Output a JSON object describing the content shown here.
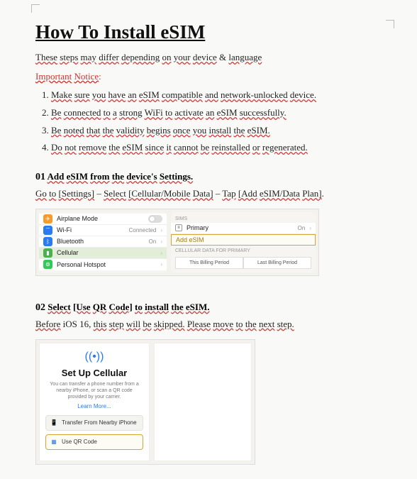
{
  "title": "How To Install eSIM",
  "intro": {
    "t1": "These",
    "t2": "steps",
    "t3": "may",
    "t4": "differ",
    "t5": "depending",
    "t6": "on",
    "t7": "your",
    "t8": "device",
    "amp": "&",
    "t9": "language"
  },
  "important": {
    "w1": "Important",
    "w2": "Notice",
    "colon": ":"
  },
  "steps": [
    {
      "n": "1.",
      "parts": [
        "Make",
        "sure",
        "you",
        "have",
        "an",
        "eSIM",
        "compatible",
        "and",
        "network-unlocked",
        "device."
      ]
    },
    {
      "n": "2.",
      "parts": [
        "Be",
        "connected",
        "to",
        "a",
        "strong",
        "WiFi",
        "to",
        "activate",
        "an",
        "eSIM",
        "successfully."
      ]
    },
    {
      "n": "3.",
      "parts": [
        "Be",
        "noted",
        "that",
        "the",
        "validity",
        "begins",
        "once",
        "you",
        "install",
        "the",
        "eSIM."
      ]
    },
    {
      "n": "4.",
      "parts": [
        "Do",
        "not",
        "remove",
        "the",
        "eSIM",
        "since",
        "it",
        "cannot",
        "be",
        "reinstalled",
        "or",
        "regenerated."
      ]
    }
  ],
  "s1": {
    "num": "01",
    "title_parts": [
      "Add",
      "eSIM",
      "from",
      "the",
      "device's",
      "Settings."
    ],
    "desc_a": "Go",
    "desc_b": "to",
    "desc_c": "[Settings]",
    "dash": "–",
    "desc_d": "Select",
    "desc_e": "[Cellular/Mobile",
    "desc_f": "Data]",
    "desc_g": "Tap",
    "desc_h": "[Add",
    "desc_i": "eSIM/Data",
    "desc_j": "Plan]",
    "left": [
      {
        "icon": "airplane",
        "label": "Airplane Mode",
        "type": "toggle"
      },
      {
        "icon": "wifi",
        "label": "Wi-Fi",
        "value": "Connected"
      },
      {
        "icon": "bt",
        "label": "Bluetooth",
        "value": "On"
      },
      {
        "icon": "cell",
        "label": "Cellular",
        "hi": true
      },
      {
        "icon": "hot",
        "label": "Personal Hotspot"
      }
    ],
    "right": {
      "sect1": "SIMs",
      "primary": "Primary",
      "on": "On",
      "add": "Add eSIM",
      "sect2": "CELLULAR DATA FOR PRIMARY",
      "seg1": "This Billing Period",
      "seg2": "Last Billing Period"
    }
  },
  "s2": {
    "num": "02",
    "title_parts": [
      "Select",
      "[Use",
      "QR",
      "Code]",
      "to",
      "install",
      "the",
      "eSIM."
    ],
    "note_a": "Before",
    "note_b": "iOS 16,",
    "note_c": "this",
    "note_d": "step",
    "note_e": "will",
    "note_f": "be",
    "note_g": "skipped.",
    "note_h": "Please",
    "note_i": "move",
    "note_j": "to",
    "note_k": "the",
    "note_l": "next",
    "note_m": "step.",
    "phone": {
      "h": "Set Up Cellular",
      "p": "You can transfer a phone number from a nearby iPhone, or scan a QR code provided by your carrier.",
      "learn": "Learn More...",
      "opt1": "Transfer From Nearby iPhone",
      "opt2": "Use QR Code"
    }
  }
}
